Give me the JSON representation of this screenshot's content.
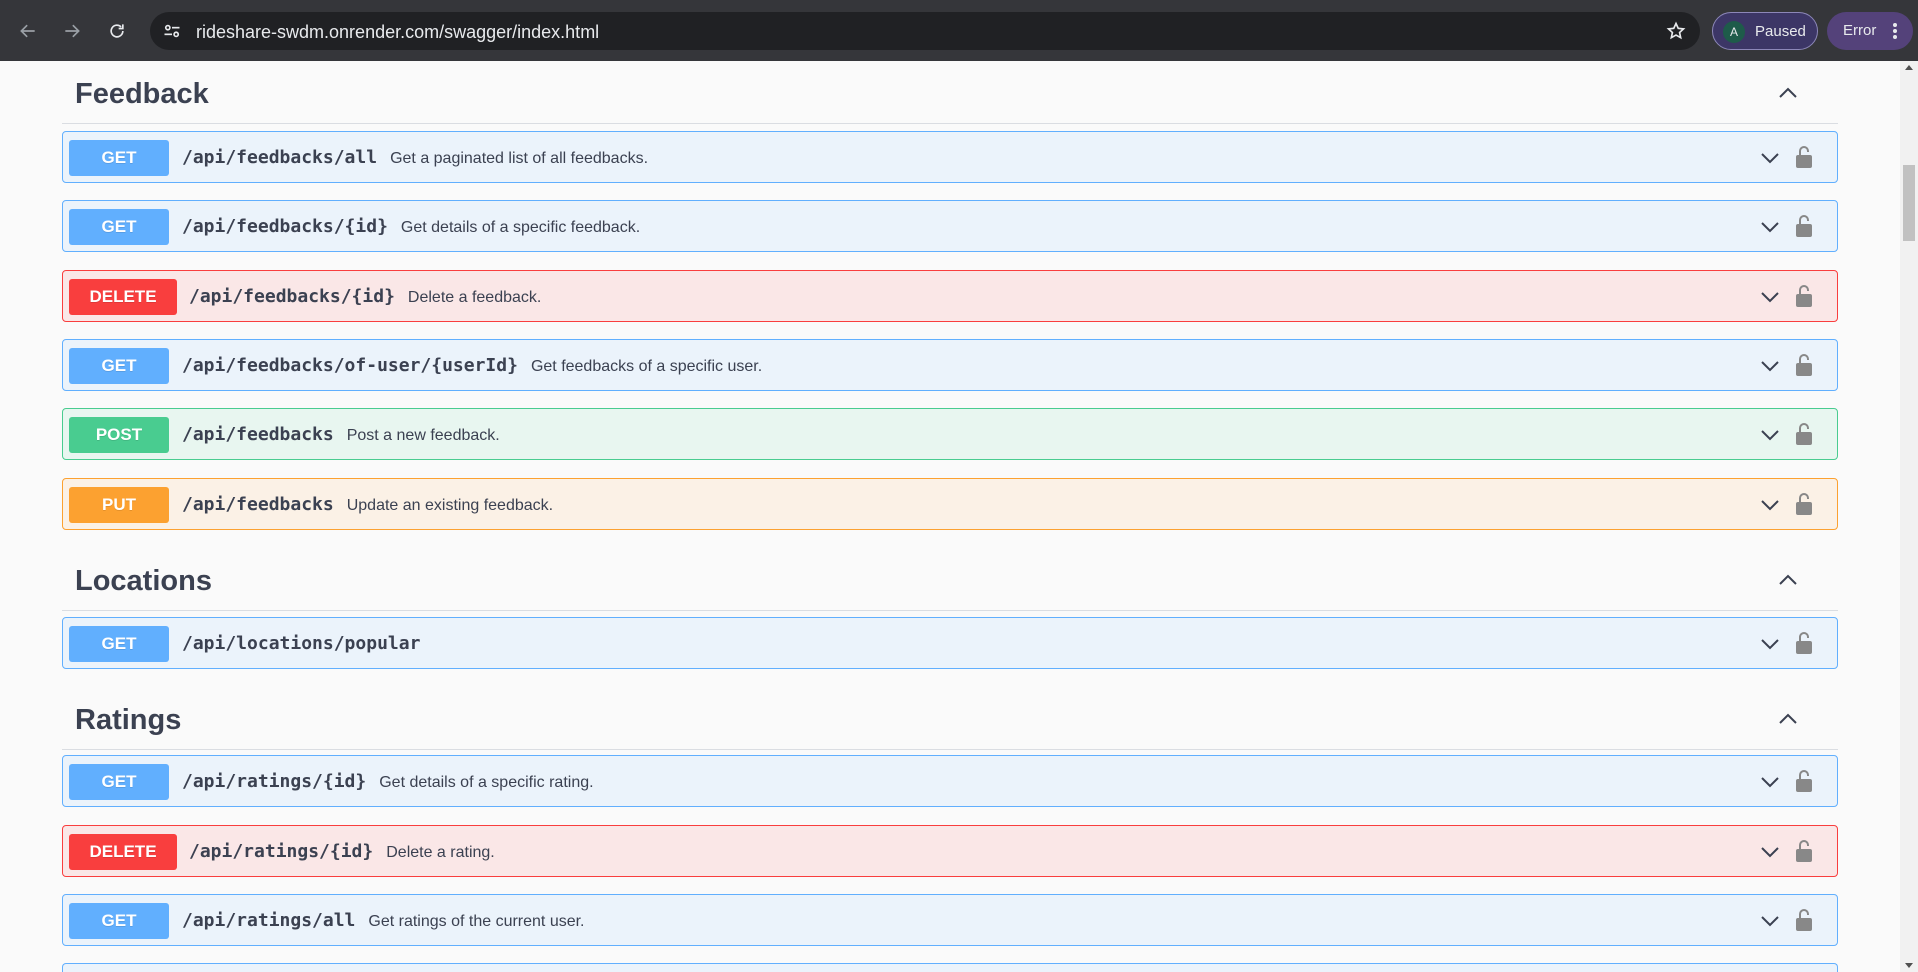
{
  "browser": {
    "url": "rideshare-swdm.onrender.com/swagger/index.html",
    "profile_initial": "A",
    "profile_status": "Paused",
    "error_label": "Error"
  },
  "sections": [
    {
      "title": "Feedback",
      "operations": [
        {
          "method": "GET",
          "path": "/api/feedbacks/all",
          "summary": "Get a paginated list of all feedbacks."
        },
        {
          "method": "GET",
          "path": "/api/feedbacks/{id}",
          "summary": "Get details of a specific feedback."
        },
        {
          "method": "DELETE",
          "path": "/api/feedbacks/{id}",
          "summary": "Delete a feedback."
        },
        {
          "method": "GET",
          "path": "/api/feedbacks/of-user/{userId}",
          "summary": "Get feedbacks of a specific user."
        },
        {
          "method": "POST",
          "path": "/api/feedbacks",
          "summary": "Post a new feedback."
        },
        {
          "method": "PUT",
          "path": "/api/feedbacks",
          "summary": "Update an existing feedback."
        }
      ]
    },
    {
      "title": "Locations",
      "operations": [
        {
          "method": "GET",
          "path": "/api/locations/popular",
          "summary": ""
        }
      ]
    },
    {
      "title": "Ratings",
      "operations": [
        {
          "method": "GET",
          "path": "/api/ratings/{id}",
          "summary": "Get details of a specific rating."
        },
        {
          "method": "DELETE",
          "path": "/api/ratings/{id}",
          "summary": "Delete a rating."
        },
        {
          "method": "GET",
          "path": "/api/ratings/all",
          "summary": "Get ratings of the current user."
        }
      ]
    }
  ],
  "colors": {
    "get": "#61affe",
    "delete": "#f93e3e",
    "post": "#49cc90",
    "put": "#fca130"
  }
}
